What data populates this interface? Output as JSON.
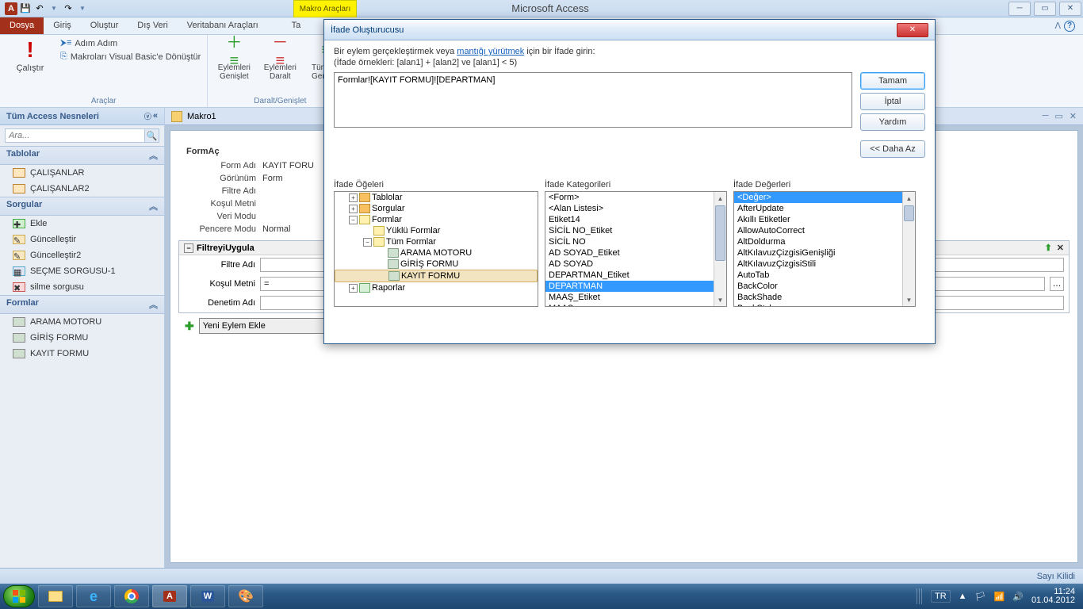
{
  "app": {
    "title": "Microsoft Access",
    "contextual_tab": "Makro Araçları"
  },
  "qat": {
    "save": "💾",
    "undo": "↶",
    "redo": "↷"
  },
  "ribbon": {
    "tabs": {
      "file": "Dosya",
      "home": "Giriş",
      "create": "Oluştur",
      "external": "Dış Veri",
      "dbtools": "Veritabanı Araçları",
      "design": "Ta"
    },
    "group1": {
      "run": "Çalıştır",
      "step": "Adım Adım",
      "convert": "Makroları Visual Basic'e Dönüştür",
      "title": "Araçlar"
    },
    "group2": {
      "expand": "Eylemleri\nGenişlet",
      "collapse": "Eylemleri\nDaralt",
      "expandall": "Tümünü\nGenişlet",
      "title": "Daralt/Genişlet"
    }
  },
  "nav": {
    "header": "Tüm Access Nesneleri",
    "search_placeholder": "Ara...",
    "sections": {
      "tables": "Tablolar",
      "queries": "Sorgular",
      "forms": "Formlar"
    },
    "tables": [
      "ÇALIŞANLAR",
      "ÇALIŞANLAR2"
    ],
    "queries": [
      "Ekle",
      "Güncelleştir",
      "Güncelleştir2",
      "SEÇME SORGUSU-1",
      "silme sorgusu"
    ],
    "forms": [
      "ARAMA MOTORU",
      "GİRİŞ FORMU",
      "KAYIT FORMU"
    ]
  },
  "doc": {
    "tab": "Makro1"
  },
  "macro": {
    "block1_title": "FormAç",
    "rows": {
      "form_name_lbl": "Form Adı",
      "form_name_val": "KAYIT FORU",
      "view_lbl": "Görünüm",
      "view_val": "Form",
      "filter_lbl": "Filtre Adı",
      "filter_val": "",
      "where_lbl": "Koşul Metni",
      "where_val": "",
      "datamode_lbl": "Veri Modu",
      "datamode_val": "",
      "winmode_lbl": "Pencere Modu",
      "winmode_val": "Normal"
    },
    "filter_block": {
      "title": "FiltreyiUygula",
      "filter_lbl": "Filtre Adı",
      "where_lbl": "Koşul Metni",
      "where_val": "=",
      "control_lbl": "Denetim Adı"
    },
    "add_action": "Yeni Eylem Ekle"
  },
  "dialog": {
    "title": "İfade Oluşturucusu",
    "hint_pre": "Bir eylem gerçekleştirmek veya ",
    "hint_link": "mantığı yürütmek",
    "hint_post": " için bir İfade girin:",
    "example": "(İfade örnekleri: [alan1] + [alan2] ve [alan1] < 5)",
    "expression": "Formlar![KAYIT FORMU]![DEPARTMAN] ",
    "buttons": {
      "ok": "Tamam",
      "cancel": "İptal",
      "help": "Yardım",
      "less": "<< Daha Az"
    },
    "col1_hdr": "İfade Öğeleri",
    "col2_hdr": "İfade Kategorileri",
    "col3_hdr": "İfade Değerleri",
    "tree": {
      "tables": "Tablolar",
      "queries": "Sorgular",
      "forms": "Formlar",
      "loaded": "Yüklü Formlar",
      "all": "Tüm Formlar",
      "f1": "ARAMA MOTORU",
      "f2": "GİRİŞ FORMU",
      "f3": "KAYIT FORMU",
      "reports": "Raporlar"
    },
    "categories": [
      "<Form>",
      "<Alan Listesi>",
      "Etiket14",
      "SİCİL NO_Etiket",
      "SİCİL NO",
      "AD SOYAD_Etiket",
      "AD SOYAD",
      "DEPARTMAN_Etiket",
      "DEPARTMAN",
      "MAAŞ_Etiket",
      "MAAŞ"
    ],
    "cat_selected": 8,
    "values": [
      "<Değer>",
      "AfterUpdate",
      "Akıllı Etiketler",
      "AllowAutoCorrect",
      "AltDoldurma",
      "AltKılavuzÇizgisiGenişliği",
      "AltKılavuzÇizgisiStili",
      "AutoTab",
      "BackColor",
      "BackShade",
      "BackStyle"
    ],
    "val_selected": 0
  },
  "status": {
    "numlock": "Sayı Kilidi"
  },
  "taskbar": {
    "lang": "TR",
    "time": "11:24",
    "date": "01.04.2012"
  }
}
